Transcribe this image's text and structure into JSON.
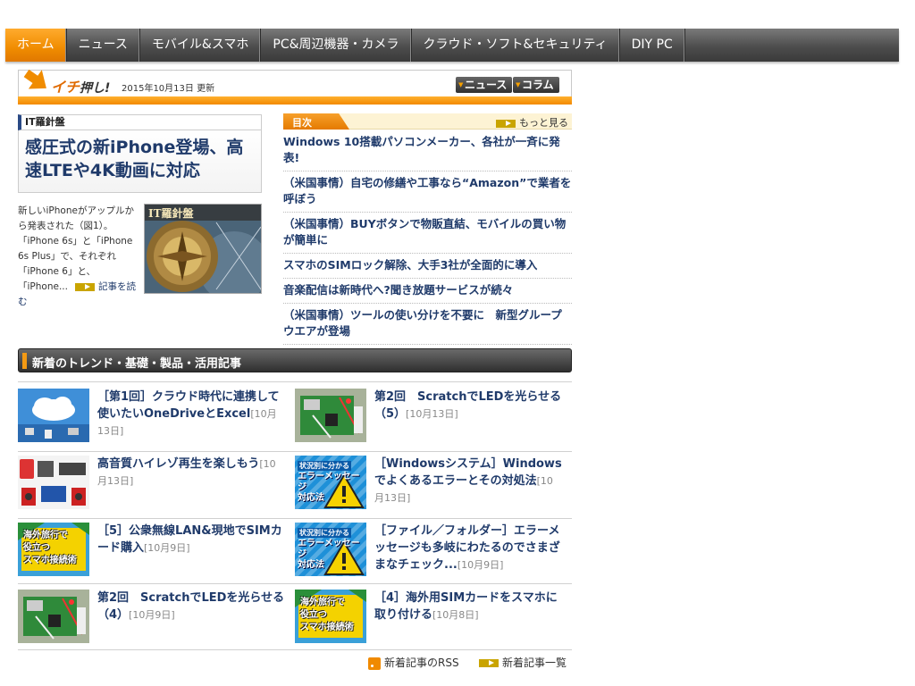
{
  "nav": [
    {
      "label": "ホーム",
      "active": true
    },
    {
      "label": "ニュース"
    },
    {
      "label": "モバイル&スマホ"
    },
    {
      "label": "PC&周辺機器・カメラ"
    },
    {
      "label": "クラウド・ソフト&セキュリティ"
    },
    {
      "label": "DIY PC"
    }
  ],
  "ichi": {
    "logo_main": "イチ",
    "logo_sub": "押し!",
    "date": "2015年10月13日 更新",
    "btn_news": "ニュース",
    "btn_column": "コラム"
  },
  "feature": {
    "category": "IT羅針盤",
    "title": "感圧式の新iPhone登場、高速LTEや4K動画に対応",
    "text": "新しいiPhoneがアップルから発表された（図1）。「iPhone 6s」と「iPhone 6s Plus」で、それぞれ「iPhone 6」と、「iPhone...",
    "more": "記事を読む",
    "image_label": "IT羅針盤"
  },
  "toc": {
    "label": "目次",
    "more": "もっと見る",
    "items": [
      "Windows 10搭載パソコンメーカー、各社が一斉に発表!",
      "（米国事情）自宅の修繕や工事なら“Amazon”で業者を呼ぼう",
      "（米国事情）BUYボタンで物販直結、モバイルの買い物が簡単に",
      "スマホのSIMロック解除、大手3社が全面的に導入",
      "音楽配信は新時代へ?聞き放題サービスが続々",
      "（米国事情）ツールの使い分けを不要に　新型グループウエアが登場"
    ]
  },
  "new_articles": {
    "header": "新着のトレンド・基礎・製品・活用記事",
    "items": [
      {
        "title": "［第1回］クラウド時代に連携して使いたいOneDriveとExcel",
        "date": "[10月13日]",
        "thumb": "cloud"
      },
      {
        "title": "第2回　ScratchでLEDを光らせる（5）",
        "date": "[10月13日]",
        "thumb": "board"
      },
      {
        "title": "高音質ハイレゾ再生を楽しもう",
        "date": "[10月13日]",
        "thumb": "audio"
      },
      {
        "title": "［Windowsシステム］Windowsでよくあるエラーとその対処法",
        "date": "[10月13日]",
        "thumb": "error"
      },
      {
        "title": "［5］公衆無線LAN&現地でSIMカード購入",
        "date": "[10月9日]",
        "thumb": "travel"
      },
      {
        "title": "［ファイル／フォルダー］エラーメッセージも多岐にわたるのでさまざまなチェック...",
        "date": "[10月9日]",
        "thumb": "error"
      },
      {
        "title": "第2回　ScratchでLEDを光らせる（4）",
        "date": "[10月9日]",
        "thumb": "board"
      },
      {
        "title": "［4］海外用SIMカードをスマホに取り付ける",
        "date": "[10月8日]",
        "thumb": "travel"
      }
    ],
    "thumb_text": {
      "error_small": "状況別に分かる",
      "error_big1": "エラーメッセージ",
      "error_big2": "対応法",
      "travel1": "海外旅行で",
      "travel2": "役立つ",
      "travel3": "スマホ接続術"
    }
  },
  "footer": {
    "rss": "新着記事のRSS",
    "list": "新着記事一覧"
  },
  "colors": {
    "accent": "#f08c00",
    "link": "#1f3a6a",
    "nav": "#4d4d4d"
  }
}
